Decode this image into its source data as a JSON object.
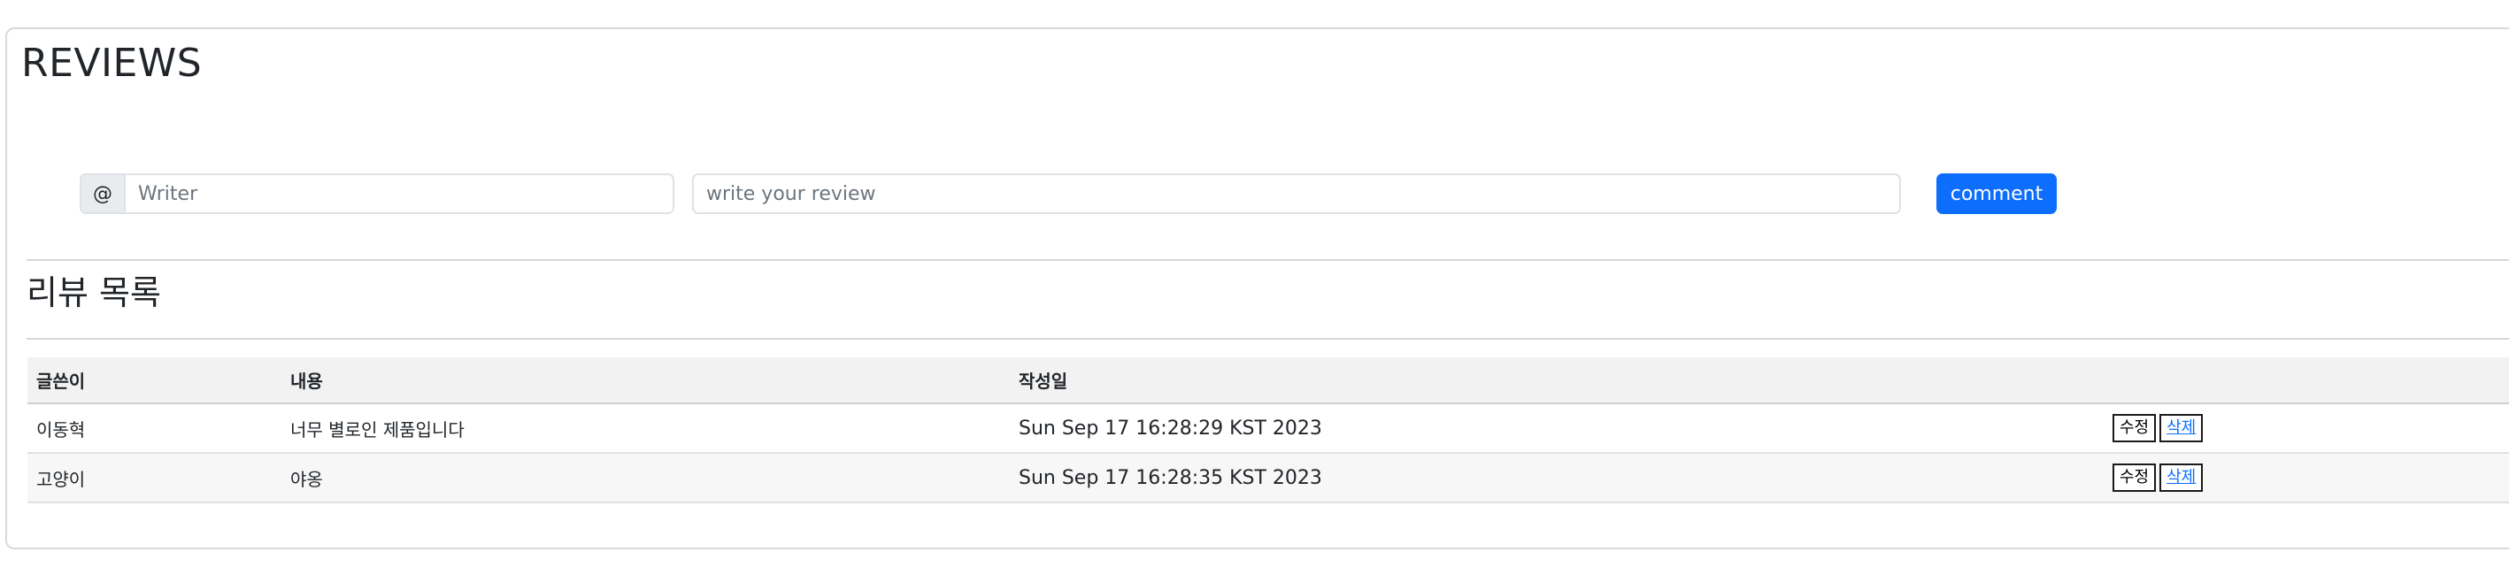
{
  "page_title": "REVIEWS",
  "form": {
    "addon_symbol": "@",
    "writer_placeholder": "Writer",
    "review_placeholder": "write your review",
    "comment_label": "comment"
  },
  "list_title": "리뷰 목록",
  "table": {
    "headers": [
      "글쓴이",
      "내용",
      "작성일",
      ""
    ],
    "rows": [
      {
        "writer": "이동혁",
        "content": "너무 별로인 제품입니다",
        "date": "Sun Sep 17 16:28:29 KST 2023",
        "edit_label": "수정",
        "delete_label": "삭제"
      },
      {
        "writer": "고양이",
        "content": "야옹",
        "date": "Sun Sep 17 16:28:35 KST 2023",
        "edit_label": "수정",
        "delete_label": "삭제"
      }
    ]
  },
  "colors": {
    "accent": "#0d6efd",
    "border": "#d9d9d9",
    "header_bg": "#f2f2f2"
  }
}
